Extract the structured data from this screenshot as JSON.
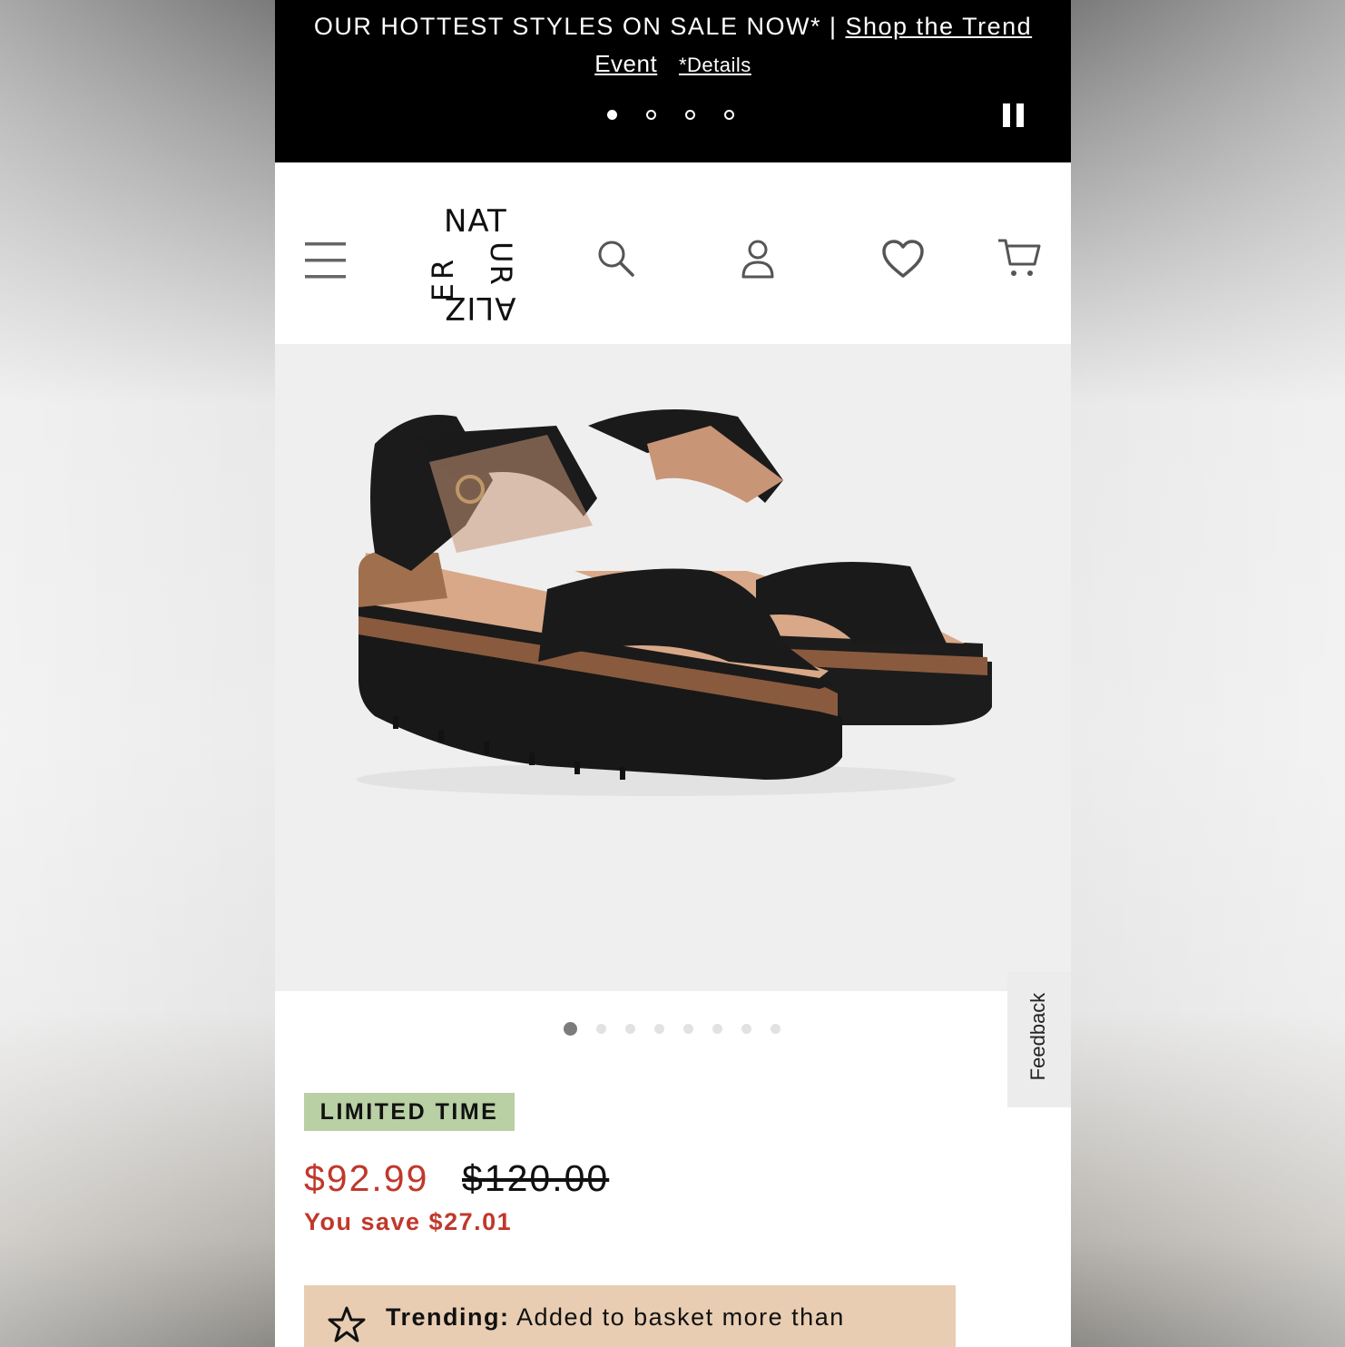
{
  "promo": {
    "headline": "OUR HOTTEST STYLES ON SALE NOW* |",
    "link_label_part1": "Shop the Trend",
    "link_label_part2": "Event",
    "details_label": "*Details",
    "slide_count": 4,
    "active_slide": 1
  },
  "header": {
    "logo": {
      "top": "NAT",
      "left": "ER",
      "right": "UR",
      "bottom": "ALIZ"
    },
    "icons": [
      "menu-icon",
      "search-icon",
      "account-icon",
      "heart-icon",
      "cart-icon"
    ]
  },
  "gallery": {
    "image_count": 8,
    "active_image": 1
  },
  "feedback_label": "Feedback",
  "product": {
    "badge": "LIMITED TIME",
    "price_now": "$92.99",
    "price_was": "$120.00",
    "you_save": "You save $27.01"
  },
  "trending": {
    "label": "Trending:",
    "text": "Added to basket more than"
  },
  "colors": {
    "sale_red": "#c0382b",
    "badge_green": "#b9cfa4",
    "trending_bg": "#e8cdb2",
    "banner_bg": "#000000"
  }
}
